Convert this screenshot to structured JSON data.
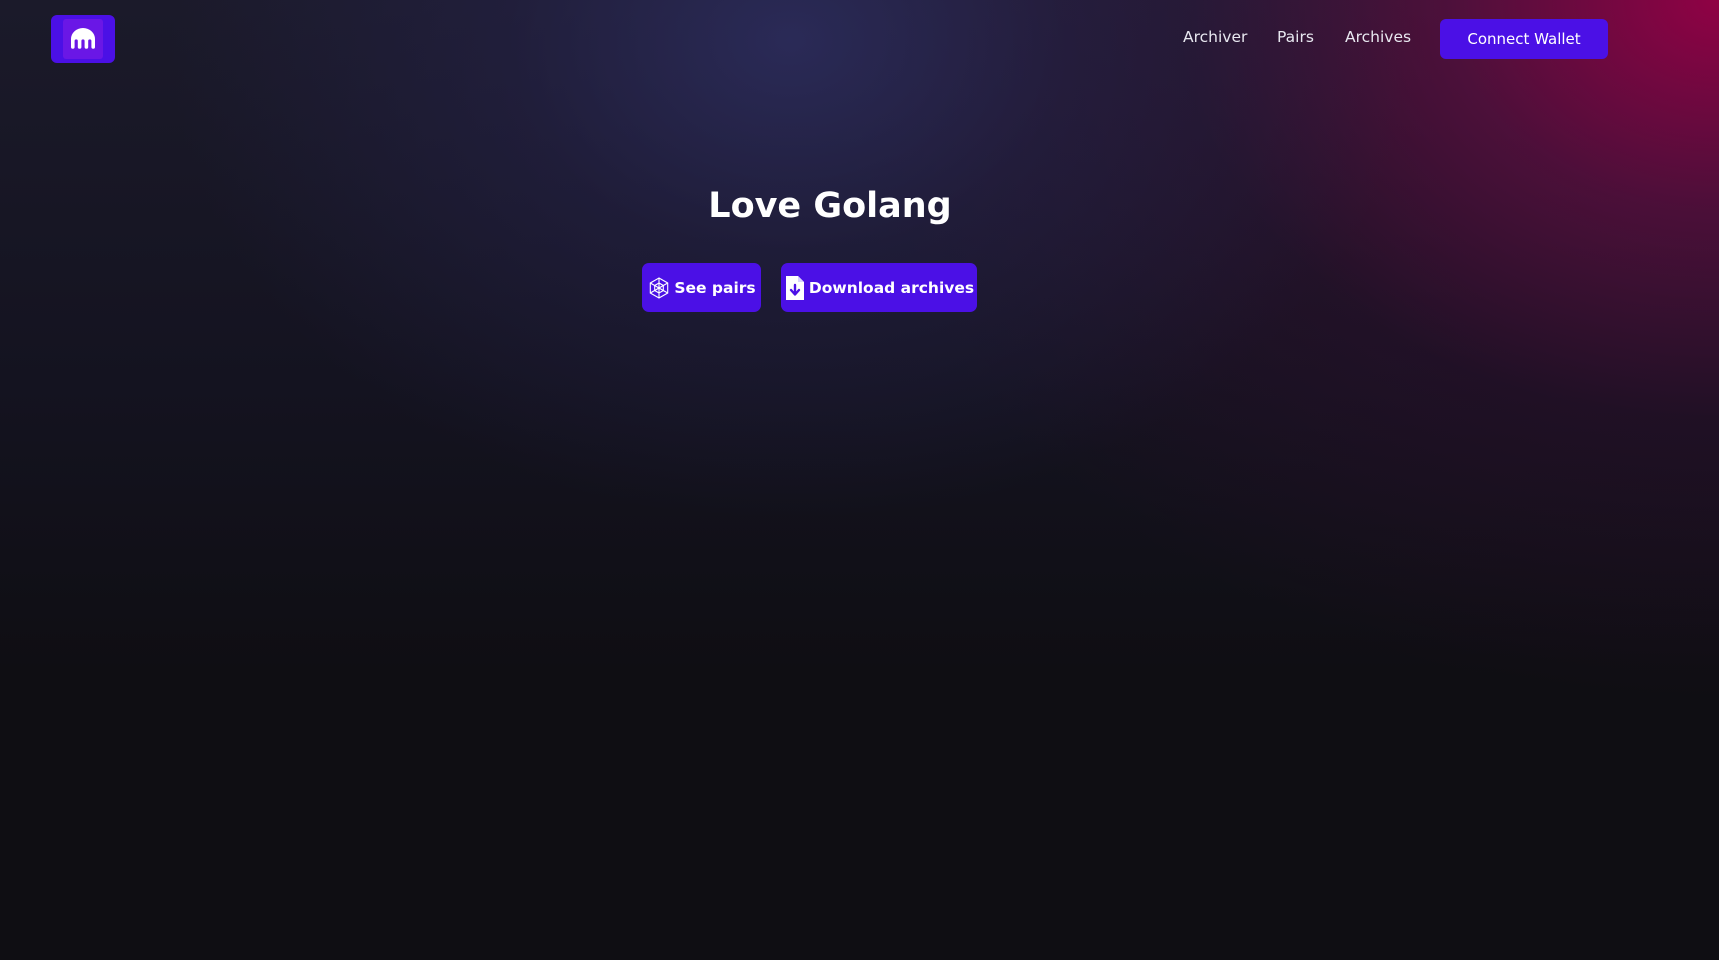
{
  "nav": {
    "logo_icon": "kraken-logo-icon",
    "links": [
      "Archiver",
      "Pairs",
      "Archives"
    ],
    "connect_label": "Connect Wallet"
  },
  "hero": {
    "title": "Love Golang",
    "see_pairs_label": "See pairs",
    "see_pairs_icon": "hexagon-network-icon",
    "download_label": "Download archives",
    "download_icon": "file-download-icon"
  },
  "colors": {
    "accent": "#4b10e6",
    "background": "#0f0e13",
    "glow_magenta": "#960046"
  }
}
